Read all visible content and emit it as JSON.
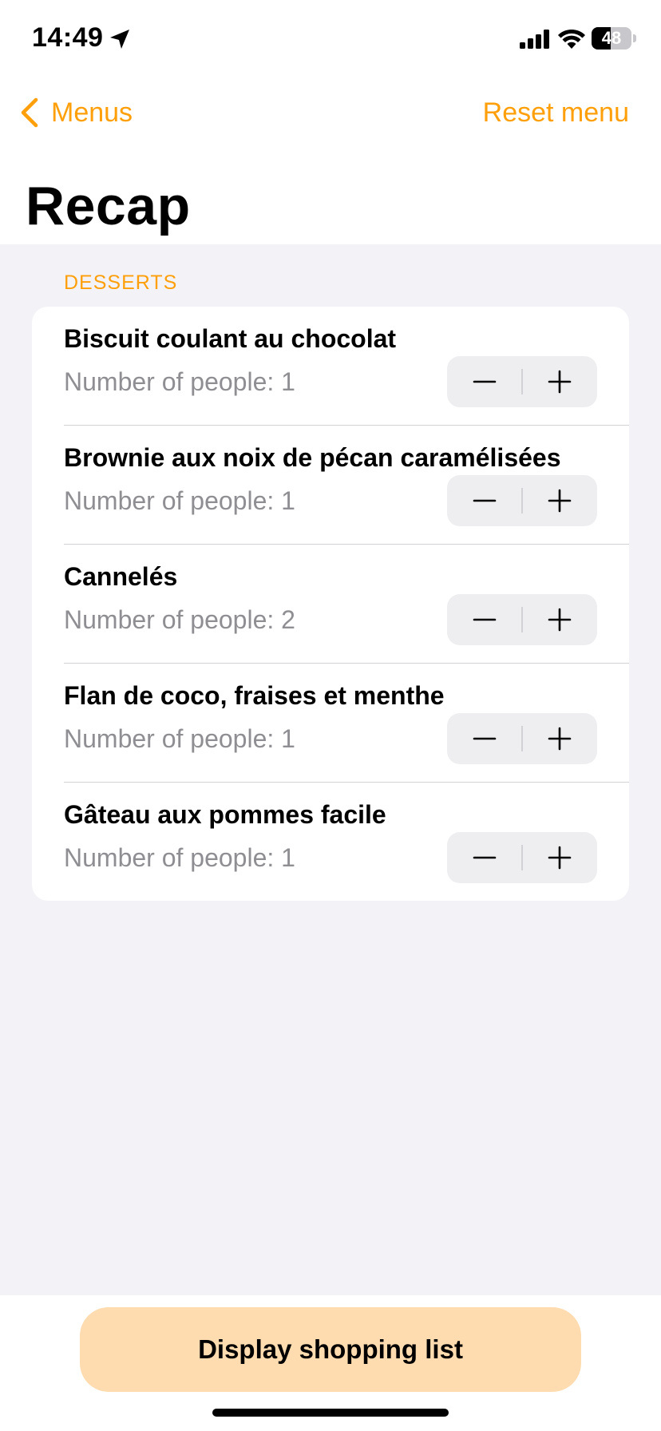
{
  "status_bar": {
    "time": "14:49",
    "battery_percent": "48",
    "battery_level": 0.48
  },
  "nav": {
    "back_label": "Menus",
    "right_action_label": "Reset menu",
    "title": "Recap"
  },
  "section": {
    "header": "DESSERTS",
    "items": [
      {
        "title": "Biscuit coulant au chocolat",
        "subtitle": "Number of people: 1"
      },
      {
        "title": "Brownie aux noix de pécan caramélisées",
        "subtitle": "Number of people: 1"
      },
      {
        "title": "Cannelés",
        "subtitle": "Number of people: 2"
      },
      {
        "title": "Flan de coco, fraises et menthe",
        "subtitle": "Number of people: 1"
      },
      {
        "title": "Gâteau aux pommes facile",
        "subtitle": "Number of people: 1"
      }
    ]
  },
  "footer": {
    "cta_label": "Display shopping list"
  },
  "colors": {
    "accent": "#ff9f0a",
    "cta_background": "#fedcb0",
    "grouped_background": "#f2f2f7",
    "secondary_text": "#8e8e93"
  },
  "icons": {
    "back": "chevron-left-icon",
    "location": "location-arrow-icon",
    "signal": "cellular-signal-icon",
    "wifi": "wifi-icon",
    "minus": "minus-icon",
    "plus": "plus-icon"
  }
}
